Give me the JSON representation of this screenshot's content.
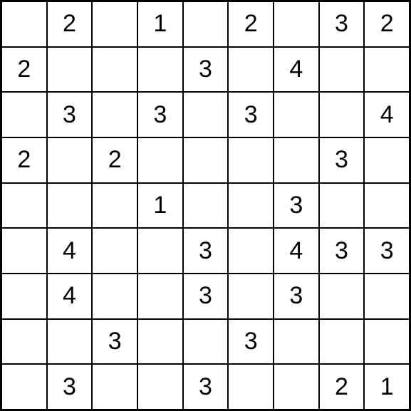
{
  "puzzle": {
    "type": "minesweeper-number-grid",
    "size": 9,
    "grid": [
      [
        "",
        "2",
        "",
        "1",
        "",
        "2",
        "",
        "3",
        "2"
      ],
      [
        "2",
        "",
        "",
        "",
        "3",
        "",
        "4",
        "",
        ""
      ],
      [
        "",
        "3",
        "",
        "3",
        "",
        "3",
        "",
        "",
        "4"
      ],
      [
        "2",
        "",
        "2",
        "",
        "",
        "",
        "",
        "3",
        ""
      ],
      [
        "",
        "",
        "",
        "1",
        "",
        "",
        "3",
        "",
        ""
      ],
      [
        "",
        "4",
        "",
        "",
        "3",
        "",
        "4",
        "3",
        "3"
      ],
      [
        "",
        "4",
        "",
        "",
        "3",
        "",
        "3",
        "",
        ""
      ],
      [
        "",
        "",
        "3",
        "",
        "",
        "3",
        "",
        "",
        ""
      ],
      [
        "",
        "3",
        "",
        "",
        "3",
        "",
        "",
        "2",
        "1"
      ]
    ]
  }
}
